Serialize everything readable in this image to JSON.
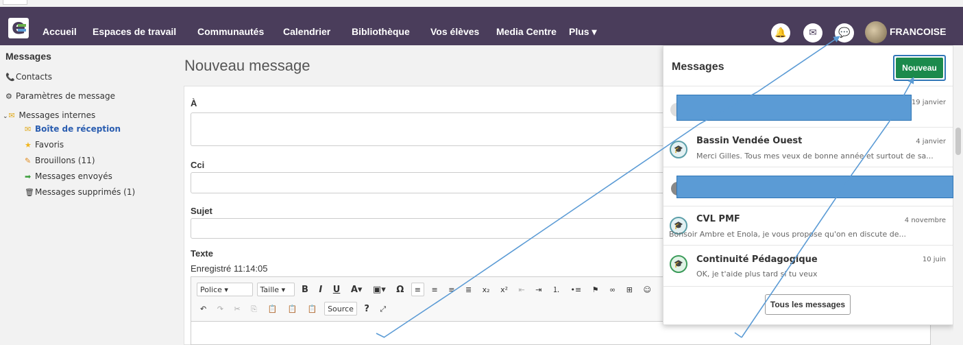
{
  "navbar": {
    "items": [
      "Accueil",
      "Espaces de travail",
      "Communautés",
      "Calendrier",
      "Bibliothèque",
      "Vos élèves",
      "Media Centre",
      "Plus ▾"
    ],
    "username": "FRANCOISE",
    "icons": [
      "bell-icon",
      "mail-icon",
      "chat-icon"
    ]
  },
  "sidebar": {
    "title": "Messages",
    "contacts": "Contacts",
    "settings": "Paramètres de message",
    "internal": "Messages internes",
    "inbox": "Boîte de réception",
    "favorites": "Favoris",
    "drafts": "Brouillons (11)",
    "sent": "Messages envoyés",
    "deleted": "Messages supprimés (1)"
  },
  "compose": {
    "title": "Nouveau message",
    "to_label": "À",
    "bcc_label": "Cci",
    "subject_label": "Sujet",
    "text_label": "Texte",
    "saved": "Enregistré 11:14:05",
    "toolbar": {
      "font": "Police",
      "size": "Taille",
      "source": "Source"
    }
  },
  "dropdown": {
    "title": "Messages",
    "new_button": "Nouveau",
    "messages": [
      {
        "name": "",
        "date": "19 janvier",
        "preview": ""
      },
      {
        "name": "Bassin Vendée Ouest",
        "date": "4 janvier",
        "preview": "Merci Gilles. Tous mes veux de bonne année et surtout de sa..."
      },
      {
        "name": "",
        "date": "",
        "preview": ""
      },
      {
        "name": "CVL PMF",
        "date": "4 novembre",
        "preview": "Bonsoir Ambre et Enola, je vous propose qu'on en discute de..."
      },
      {
        "name": "Continuité Pédagogique",
        "date": "10 juin",
        "preview": "OK, je t'aide plus tard si tu veux"
      }
    ],
    "all_button": "Tous les messages"
  },
  "colors": {
    "navbar": "#4a3d5b",
    "new_button": "#1b8a4c",
    "annotation": "#5b9bd5"
  }
}
